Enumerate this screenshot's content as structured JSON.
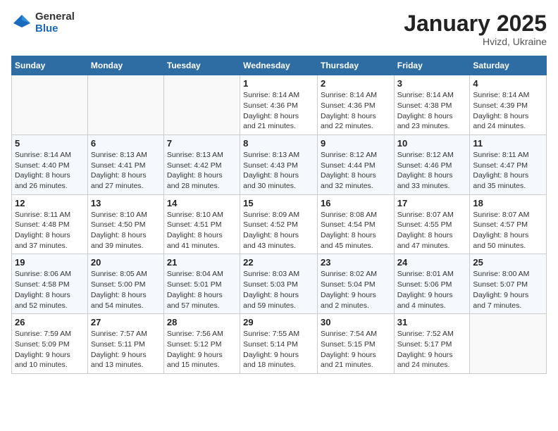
{
  "logo": {
    "general": "General",
    "blue": "Blue"
  },
  "title": "January 2025",
  "subtitle": "Hvizd, Ukraine",
  "days_of_week": [
    "Sunday",
    "Monday",
    "Tuesday",
    "Wednesday",
    "Thursday",
    "Friday",
    "Saturday"
  ],
  "weeks": [
    [
      {
        "day": "",
        "info": ""
      },
      {
        "day": "",
        "info": ""
      },
      {
        "day": "",
        "info": ""
      },
      {
        "day": "1",
        "info": "Sunrise: 8:14 AM\nSunset: 4:36 PM\nDaylight: 8 hours\nand 21 minutes."
      },
      {
        "day": "2",
        "info": "Sunrise: 8:14 AM\nSunset: 4:36 PM\nDaylight: 8 hours\nand 22 minutes."
      },
      {
        "day": "3",
        "info": "Sunrise: 8:14 AM\nSunset: 4:38 PM\nDaylight: 8 hours\nand 23 minutes."
      },
      {
        "day": "4",
        "info": "Sunrise: 8:14 AM\nSunset: 4:39 PM\nDaylight: 8 hours\nand 24 minutes."
      }
    ],
    [
      {
        "day": "5",
        "info": "Sunrise: 8:14 AM\nSunset: 4:40 PM\nDaylight: 8 hours\nand 26 minutes."
      },
      {
        "day": "6",
        "info": "Sunrise: 8:13 AM\nSunset: 4:41 PM\nDaylight: 8 hours\nand 27 minutes."
      },
      {
        "day": "7",
        "info": "Sunrise: 8:13 AM\nSunset: 4:42 PM\nDaylight: 8 hours\nand 28 minutes."
      },
      {
        "day": "8",
        "info": "Sunrise: 8:13 AM\nSunset: 4:43 PM\nDaylight: 8 hours\nand 30 minutes."
      },
      {
        "day": "9",
        "info": "Sunrise: 8:12 AM\nSunset: 4:44 PM\nDaylight: 8 hours\nand 32 minutes."
      },
      {
        "day": "10",
        "info": "Sunrise: 8:12 AM\nSunset: 4:46 PM\nDaylight: 8 hours\nand 33 minutes."
      },
      {
        "day": "11",
        "info": "Sunrise: 8:11 AM\nSunset: 4:47 PM\nDaylight: 8 hours\nand 35 minutes."
      }
    ],
    [
      {
        "day": "12",
        "info": "Sunrise: 8:11 AM\nSunset: 4:48 PM\nDaylight: 8 hours\nand 37 minutes."
      },
      {
        "day": "13",
        "info": "Sunrise: 8:10 AM\nSunset: 4:50 PM\nDaylight: 8 hours\nand 39 minutes."
      },
      {
        "day": "14",
        "info": "Sunrise: 8:10 AM\nSunset: 4:51 PM\nDaylight: 8 hours\nand 41 minutes."
      },
      {
        "day": "15",
        "info": "Sunrise: 8:09 AM\nSunset: 4:52 PM\nDaylight: 8 hours\nand 43 minutes."
      },
      {
        "day": "16",
        "info": "Sunrise: 8:08 AM\nSunset: 4:54 PM\nDaylight: 8 hours\nand 45 minutes."
      },
      {
        "day": "17",
        "info": "Sunrise: 8:07 AM\nSunset: 4:55 PM\nDaylight: 8 hours\nand 47 minutes."
      },
      {
        "day": "18",
        "info": "Sunrise: 8:07 AM\nSunset: 4:57 PM\nDaylight: 8 hours\nand 50 minutes."
      }
    ],
    [
      {
        "day": "19",
        "info": "Sunrise: 8:06 AM\nSunset: 4:58 PM\nDaylight: 8 hours\nand 52 minutes."
      },
      {
        "day": "20",
        "info": "Sunrise: 8:05 AM\nSunset: 5:00 PM\nDaylight: 8 hours\nand 54 minutes."
      },
      {
        "day": "21",
        "info": "Sunrise: 8:04 AM\nSunset: 5:01 PM\nDaylight: 8 hours\nand 57 minutes."
      },
      {
        "day": "22",
        "info": "Sunrise: 8:03 AM\nSunset: 5:03 PM\nDaylight: 8 hours\nand 59 minutes."
      },
      {
        "day": "23",
        "info": "Sunrise: 8:02 AM\nSunset: 5:04 PM\nDaylight: 9 hours\nand 2 minutes."
      },
      {
        "day": "24",
        "info": "Sunrise: 8:01 AM\nSunset: 5:06 PM\nDaylight: 9 hours\nand 4 minutes."
      },
      {
        "day": "25",
        "info": "Sunrise: 8:00 AM\nSunset: 5:07 PM\nDaylight: 9 hours\nand 7 minutes."
      }
    ],
    [
      {
        "day": "26",
        "info": "Sunrise: 7:59 AM\nSunset: 5:09 PM\nDaylight: 9 hours\nand 10 minutes."
      },
      {
        "day": "27",
        "info": "Sunrise: 7:57 AM\nSunset: 5:11 PM\nDaylight: 9 hours\nand 13 minutes."
      },
      {
        "day": "28",
        "info": "Sunrise: 7:56 AM\nSunset: 5:12 PM\nDaylight: 9 hours\nand 15 minutes."
      },
      {
        "day": "29",
        "info": "Sunrise: 7:55 AM\nSunset: 5:14 PM\nDaylight: 9 hours\nand 18 minutes."
      },
      {
        "day": "30",
        "info": "Sunrise: 7:54 AM\nSunset: 5:15 PM\nDaylight: 9 hours\nand 21 minutes."
      },
      {
        "day": "31",
        "info": "Sunrise: 7:52 AM\nSunset: 5:17 PM\nDaylight: 9 hours\nand 24 minutes."
      },
      {
        "day": "",
        "info": ""
      }
    ]
  ]
}
